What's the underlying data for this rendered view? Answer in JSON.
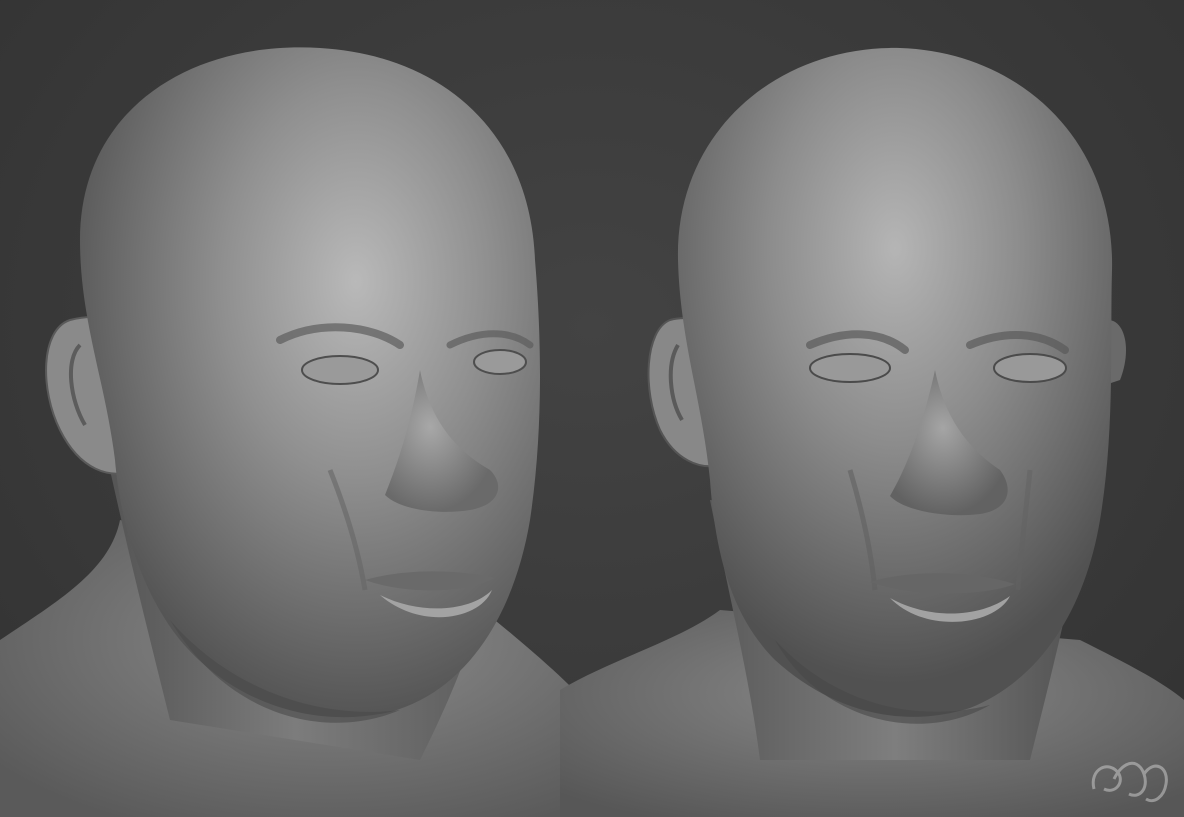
{
  "scene": {
    "description_colors": {
      "background": "#3a3a3a",
      "clay_light": "#b8b8b8",
      "clay_mid": "#8a8a8a",
      "clay_dark": "#4a4a4a"
    },
    "renders": [
      {
        "id": "left",
        "subject": "sculpted-bald-male-head-three-quarter-view"
      },
      {
        "id": "right",
        "subject": "sculpted-bald-male-head-near-front-view"
      }
    ],
    "watermark_icon": "artist-monogram-logo"
  }
}
